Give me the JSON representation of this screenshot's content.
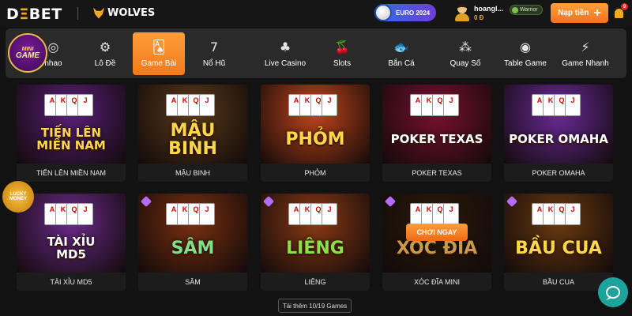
{
  "header": {
    "logo_prefix": "D",
    "logo_o": "Ξ",
    "logo_suffix": "BET",
    "partner": "WOLVES",
    "euro_label": "EURO 2024",
    "username": "hoangl...",
    "balance": "0 Đ",
    "rank": "Warrior",
    "deposit_label": "Nạp tiền",
    "deposit_plus": "+",
    "notification_count": "9"
  },
  "minigame": {
    "line1": "MINI",
    "line2": "GAME"
  },
  "nav": {
    "items": [
      {
        "label": "nhao",
        "icon": "◎"
      },
      {
        "label": "Lô Đề",
        "icon": "⚙"
      },
      {
        "label": "Game Bài",
        "icon": "🂡",
        "active": true
      },
      {
        "label": "Nổ Hũ",
        "icon": "7"
      },
      {
        "label": "Live Casino",
        "icon": "♣"
      },
      {
        "label": "Slots",
        "icon": "🍒"
      },
      {
        "label": "Bắn Cá",
        "icon": "🐟"
      },
      {
        "label": "Quay Số",
        "icon": "⁂"
      },
      {
        "label": "Table Game",
        "icon": "◉"
      },
      {
        "label": "Game Nhanh",
        "icon": "⚡"
      }
    ]
  },
  "games": [
    {
      "title": "TIẾN LÊN MIỀN NAM",
      "art": "TIẾN LÊN\nMIỀN NAM",
      "bg": "#5a1f7a",
      "fg": "#ffd84a"
    },
    {
      "title": "MẬU BINH",
      "art": "MẬU BINH",
      "bg": "#5b3a1a",
      "fg": "#ffd84a"
    },
    {
      "title": "PHỎM",
      "art": "PHỎM",
      "bg": "#c2451a",
      "fg": "#ffd84a"
    },
    {
      "title": "POKER TEXAS",
      "art": "POKER TEXAS",
      "bg": "#7a1030",
      "fg": "#ffffff"
    },
    {
      "title": "POKER OMAHA",
      "art": "POKER OMAHA",
      "bg": "#6a2a9a",
      "fg": "#ffffff"
    },
    {
      "title": "TÀI XỈU MD5",
      "art": "TÀI XỈU\nMD5",
      "bg": "#6a2a8a",
      "fg": "#ffffff"
    },
    {
      "title": "SÂM",
      "art": "SÂM",
      "bg": "#7a3010",
      "fg": "#7fe08a"
    },
    {
      "title": "LIÊNG",
      "art": "LIÊNG",
      "bg": "#8a3a14",
      "fg": "#8be04a"
    },
    {
      "title": "XÓC ĐĨA MINI",
      "art": "XÓC ĐĨA",
      "bg": "#2a1a0a",
      "fg": "#c89a4a",
      "button": "CHƠI NGAY"
    },
    {
      "title": "BẦU CUA",
      "art": "BẦU CUA",
      "bg": "#6a3a10",
      "fg": "#ffd84a"
    }
  ],
  "lucky_money": "LUCKY MONEY",
  "load_more": "Tải thêm 10/19 Games"
}
